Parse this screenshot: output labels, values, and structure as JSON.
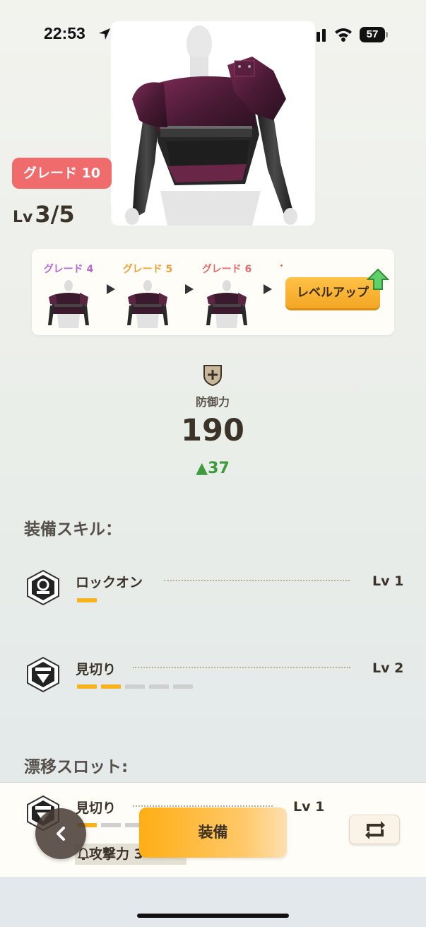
{
  "status_bar": {
    "time": "22:53",
    "battery": "57"
  },
  "item": {
    "grade_badge": "グレード 10",
    "level_prefix": "Lv",
    "level_value": "3/5"
  },
  "upgrade": {
    "steps": [
      {
        "label": "グレード 4",
        "color": "#b46ad0"
      },
      {
        "label": "グレード 5",
        "color": "#e9a23a"
      },
      {
        "label": "グレード 6",
        "color": "#e46a6a"
      }
    ],
    "button_label": "レベルアップ"
  },
  "defense": {
    "label": "防御力",
    "value": "190",
    "delta": "▲37"
  },
  "equipped_skills": {
    "title": "装備スキル：",
    "items": [
      {
        "name": "ロックオン",
        "level": "Lv 1",
        "filled": 1,
        "total": 1
      },
      {
        "name": "見切り",
        "level": "Lv 2",
        "filled": 2,
        "total": 5
      }
    ]
  },
  "drift_slot": {
    "title": "漂移スロット:",
    "skill": {
      "name": "見切り",
      "level": "Lv 1",
      "filled": 1,
      "total": 3
    },
    "attack_chip": "攻撃力 3"
  },
  "actions": {
    "equip_label": "装備"
  },
  "colors": {
    "accent": "#f7b21e",
    "grade_badge": "#f06b6b",
    "delta_green": "#3d9a3d"
  }
}
